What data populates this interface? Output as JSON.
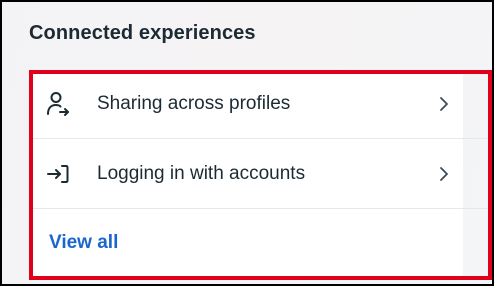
{
  "section": {
    "title": "Connected experiences"
  },
  "items": [
    {
      "label": "Sharing across profiles",
      "icon": "profile-share-icon"
    },
    {
      "label": "Logging in with accounts",
      "icon": "login-arrow-icon"
    }
  ],
  "view_all_label": "View all",
  "colors": {
    "text": "#1c2b33",
    "link": "#1a66d0",
    "highlight": "#e0001b",
    "divider": "#e6e8ea"
  }
}
